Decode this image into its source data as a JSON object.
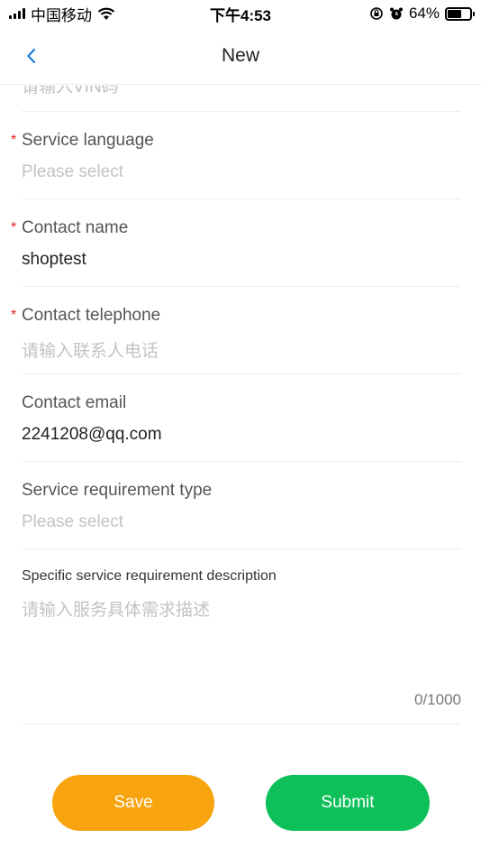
{
  "status_bar": {
    "carrier": "中国移动",
    "time": "下午4:53",
    "battery": "64%",
    "battery_level": 0.64
  },
  "nav": {
    "title": "New"
  },
  "form": {
    "vin_placeholder": "请输入VIN码",
    "fields": [
      {
        "label": "Service language",
        "required": true,
        "value": "",
        "placeholder": "Please select"
      },
      {
        "label": "Contact name",
        "required": true,
        "value": "shoptest",
        "placeholder": ""
      },
      {
        "label": "Contact telephone",
        "required": true,
        "value": "",
        "placeholder": "请输入联系人电话"
      },
      {
        "label": "Contact email",
        "required": false,
        "value": "2241208@qq.com",
        "placeholder": ""
      },
      {
        "label": "Service requirement type",
        "required": false,
        "value": "",
        "placeholder": "Please select"
      }
    ],
    "description": {
      "label": "Specific service requirement description",
      "placeholder": "请输入服务具体需求描述",
      "counter": "0/1000"
    }
  },
  "buttons": {
    "save": "Save",
    "submit": "Submit"
  },
  "colors": {
    "required_mark": "#e02020",
    "save": "#f8a40e",
    "submit": "#0dc05a",
    "back_arrow": "#1e7bd9"
  }
}
